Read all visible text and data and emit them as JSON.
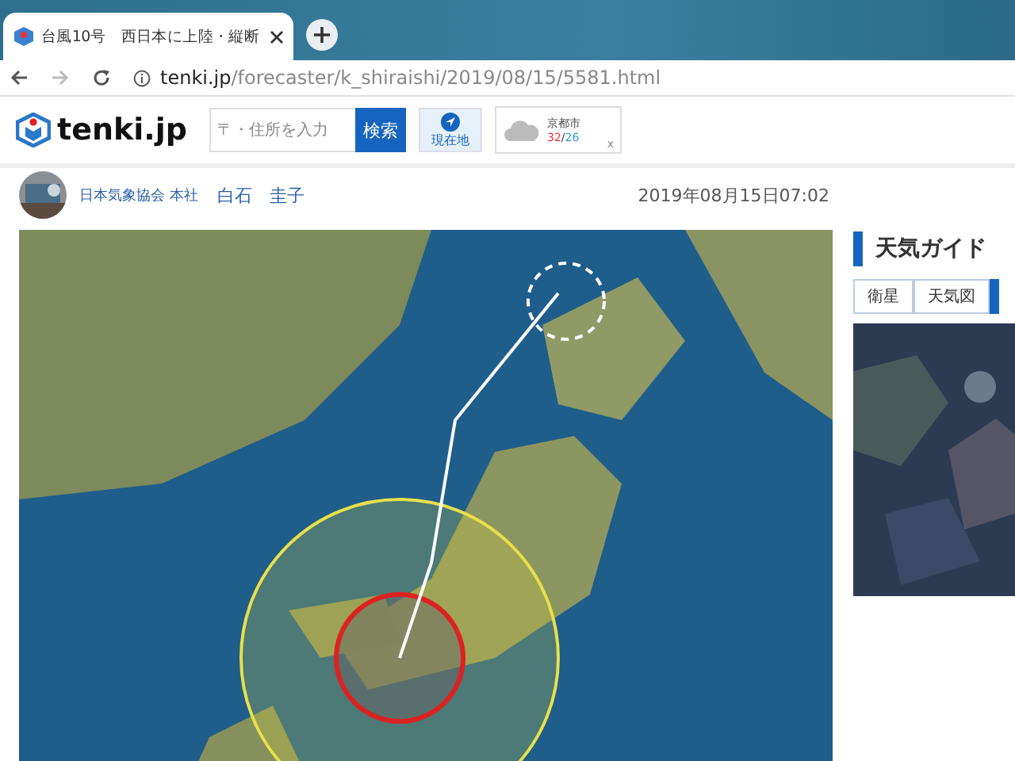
{
  "browser": {
    "tab_title": "台風10号　西日本に上陸・縦断",
    "url_host": "tenki.jp",
    "url_path": "/forecaster/k_shiraishi/2019/08/15/5581.html"
  },
  "site": {
    "logo": "tenki.jp",
    "search": {
      "placeholder": "〒・住所を入力"
    },
    "search_button": "検索",
    "location_button": "現在地",
    "weather": {
      "city": "京都市",
      "high": "32",
      "separator": "/",
      "low": "26",
      "close": "x"
    }
  },
  "article": {
    "organization": "日本気象協会 本社",
    "author": "白石　圭子",
    "date": "2019年08月15日07:02"
  },
  "sidebar": {
    "title": "天気ガイド",
    "tabs": [
      {
        "label": "衛星",
        "selected": false
      },
      {
        "label": "天気図",
        "selected": false
      }
    ]
  }
}
